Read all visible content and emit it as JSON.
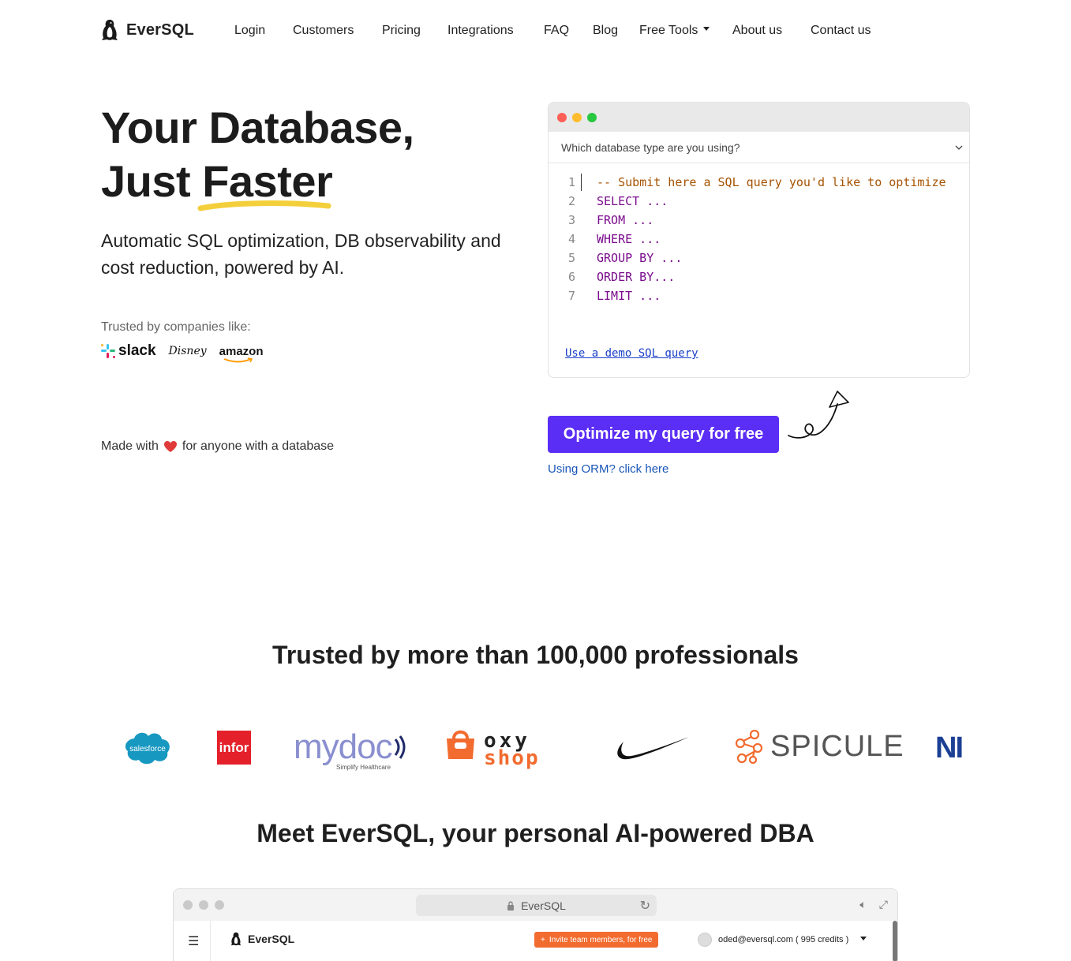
{
  "nav": {
    "brand": "EverSQL",
    "links": [
      "Login",
      "Customers",
      "Pricing",
      "Integrations",
      "FAQ",
      "Blog",
      "Free Tools",
      "About us",
      "Contact us"
    ]
  },
  "hero": {
    "title_line1": "Your Database,",
    "title_line2": "Just Faster",
    "subtitle": "Automatic SQL optimization, DB observability and cost reduction, powered by AI.",
    "trusted_label": "Trusted by companies like:",
    "companies": [
      "slack",
      "Disney",
      "amazon"
    ],
    "made_with_prefix": "Made with",
    "made_with_suffix": "for anyone with a database"
  },
  "editor": {
    "db_select_placeholder": "Which database type are you using?",
    "lines": [
      {
        "num": "1",
        "text": "-- Submit here a SQL query you'd like to optimize"
      },
      {
        "num": "2",
        "text": "SELECT ..."
      },
      {
        "num": "3",
        "text": "FROM ..."
      },
      {
        "num": "4",
        "text": "WHERE ..."
      },
      {
        "num": "5",
        "text": "GROUP BY ..."
      },
      {
        "num": "6",
        "text": "ORDER BY..."
      },
      {
        "num": "7",
        "text": "LIMIT ..."
      }
    ],
    "demo_link": "Use a demo SQL query"
  },
  "cta": {
    "button": "Optimize my query for free",
    "orm_link": "Using ORM? click here"
  },
  "trusted": {
    "heading": "Trusted by more than 100,000 professionals",
    "brands": [
      "salesforce",
      "infor",
      "mydoc",
      "Simplify Healthcare",
      "oxy",
      "shop",
      "nike",
      "SPICULE",
      "NI"
    ]
  },
  "meet": {
    "heading": "Meet EverSQL, your personal AI-powered DBA"
  },
  "browser": {
    "url": "EverSQL",
    "app_brand": "EverSQL",
    "invite_label": "Invite team members, for free",
    "user": "oded@eversql.com ( 995 credits )"
  },
  "colors": {
    "cta": "#5b2ef5",
    "underline": "#f4cf3c",
    "keyword": "#7a0b8c",
    "comment": "#a65200",
    "link": "#1a56b8"
  }
}
